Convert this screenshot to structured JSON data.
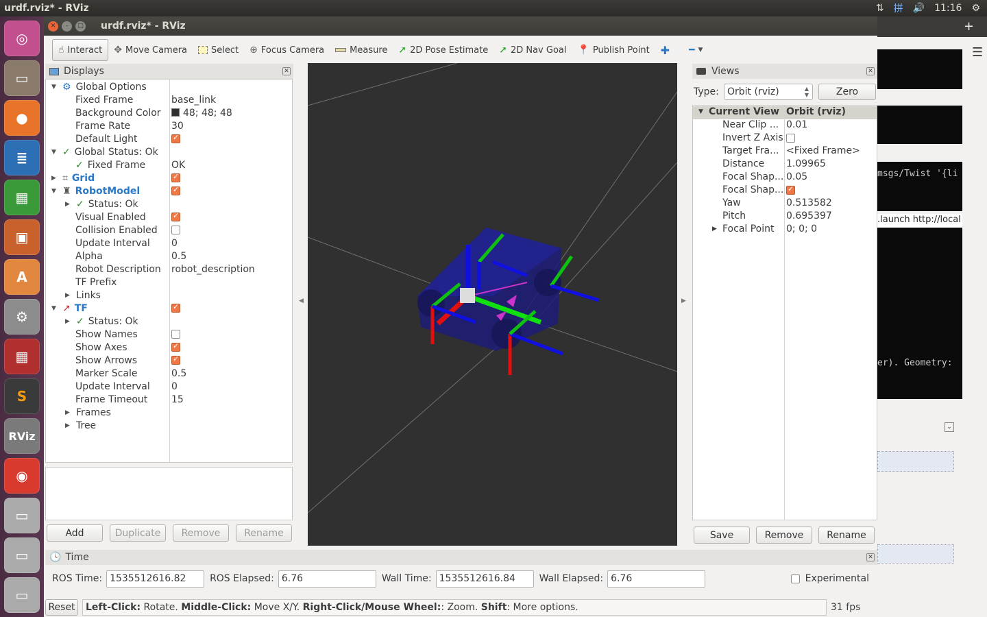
{
  "system": {
    "title": "urdf.rviz* - RViz",
    "clock": "11:16",
    "tray_icons": [
      "network-icon",
      "input-method-icon",
      "volume-icon",
      "settings-icon"
    ],
    "input_method": "拼"
  },
  "launcher": {
    "items": [
      "ubuntu-dash",
      "files",
      "firefox",
      "writer",
      "calc",
      "impress",
      "software-center",
      "system-settings",
      "workspaces",
      "sublime-text",
      "rviz",
      "netease-music",
      "drive-1",
      "drive-2",
      "drive-3"
    ]
  },
  "window": {
    "title": "urdf.rviz* - RViz"
  },
  "toolbar": {
    "interact": "Interact",
    "move_camera": "Move Camera",
    "select": "Select",
    "focus_camera": "Focus Camera",
    "measure": "Measure",
    "pose_estimate": "2D Pose Estimate",
    "nav_goal": "2D Nav Goal",
    "publish_point": "Publish Point"
  },
  "displays": {
    "title": "Displays",
    "rows": {
      "global_options": "Global Options",
      "fixed_frame": "Fixed Frame",
      "fixed_frame_val": "base_link",
      "bg_color": "Background Color",
      "bg_color_val": "48; 48; 48",
      "frame_rate": "Frame Rate",
      "frame_rate_val": "30",
      "default_light": "Default Light",
      "global_status": "Global Status: Ok",
      "gs_fixed_frame": "Fixed Frame",
      "gs_fixed_frame_val": "OK",
      "grid": "Grid",
      "robot_model": "RobotModel",
      "rm_status": "Status: Ok",
      "visual_enabled": "Visual Enabled",
      "collision_enabled": "Collision Enabled",
      "update_interval": "Update Interval",
      "update_interval_val": "0",
      "alpha": "Alpha",
      "alpha_val": "0.5",
      "robot_description": "Robot Description",
      "robot_description_val": "robot_description",
      "tf_prefix": "TF Prefix",
      "links": "Links",
      "tf": "TF",
      "tf_status": "Status: Ok",
      "show_names": "Show Names",
      "show_axes": "Show Axes",
      "show_arrows": "Show Arrows",
      "marker_scale": "Marker Scale",
      "marker_scale_val": "0.5",
      "tf_update_interval": "Update Interval",
      "tf_update_interval_val": "0",
      "frame_timeout": "Frame Timeout",
      "frame_timeout_val": "15",
      "frames": "Frames",
      "tree": "Tree"
    },
    "buttons": {
      "add": "Add",
      "duplicate": "Duplicate",
      "remove": "Remove",
      "rename": "Rename"
    }
  },
  "views": {
    "title": "Views",
    "type_label": "Type:",
    "type_value": "Orbit (rviz)",
    "zero": "Zero",
    "header_left": "Current View",
    "header_right": "Orbit (rviz)",
    "rows": [
      {
        "label": "Near Clip ...",
        "value": "0.01"
      },
      {
        "label": "Invert Z Axis",
        "value": ""
      },
      {
        "label": "Target Fra...",
        "value": "<Fixed Frame>"
      },
      {
        "label": "Distance",
        "value": "1.09965"
      },
      {
        "label": "Focal Shap...",
        "value": "0.05"
      },
      {
        "label": "Focal Shap...",
        "value": ""
      },
      {
        "label": "Yaw",
        "value": "0.513582"
      },
      {
        "label": "Pitch",
        "value": "0.695397"
      },
      {
        "label": "Focal Point",
        "value": "0; 0; 0"
      }
    ],
    "buttons": {
      "save": "Save",
      "remove": "Remove",
      "rename": "Rename"
    }
  },
  "time": {
    "title": "Time",
    "ros_time_label": "ROS Time:",
    "ros_time": "1535512616.82",
    "ros_elapsed_label": "ROS Elapsed:",
    "ros_elapsed": "6.76",
    "wall_time_label": "Wall Time:",
    "wall_time": "1535512616.84",
    "wall_elapsed_label": "Wall Elapsed:",
    "wall_elapsed": "6.76",
    "experimental": "Experimental"
  },
  "status": {
    "reset": "Reset",
    "k1": "Left-Click:",
    "v1": " Rotate. ",
    "k2": "Middle-Click:",
    "v2": " Move X/Y. ",
    "k3": "Right-Click/Mouse Wheel:",
    "v3": ": Zoom. ",
    "k4": "Shift",
    "v4": ": More options.",
    "fps": "31 fps"
  },
  "bg_terminal": {
    "line1": " msgs/Twist '{li",
    "line2": ".launch http://local",
    "line3": "er). Geometry: "
  }
}
